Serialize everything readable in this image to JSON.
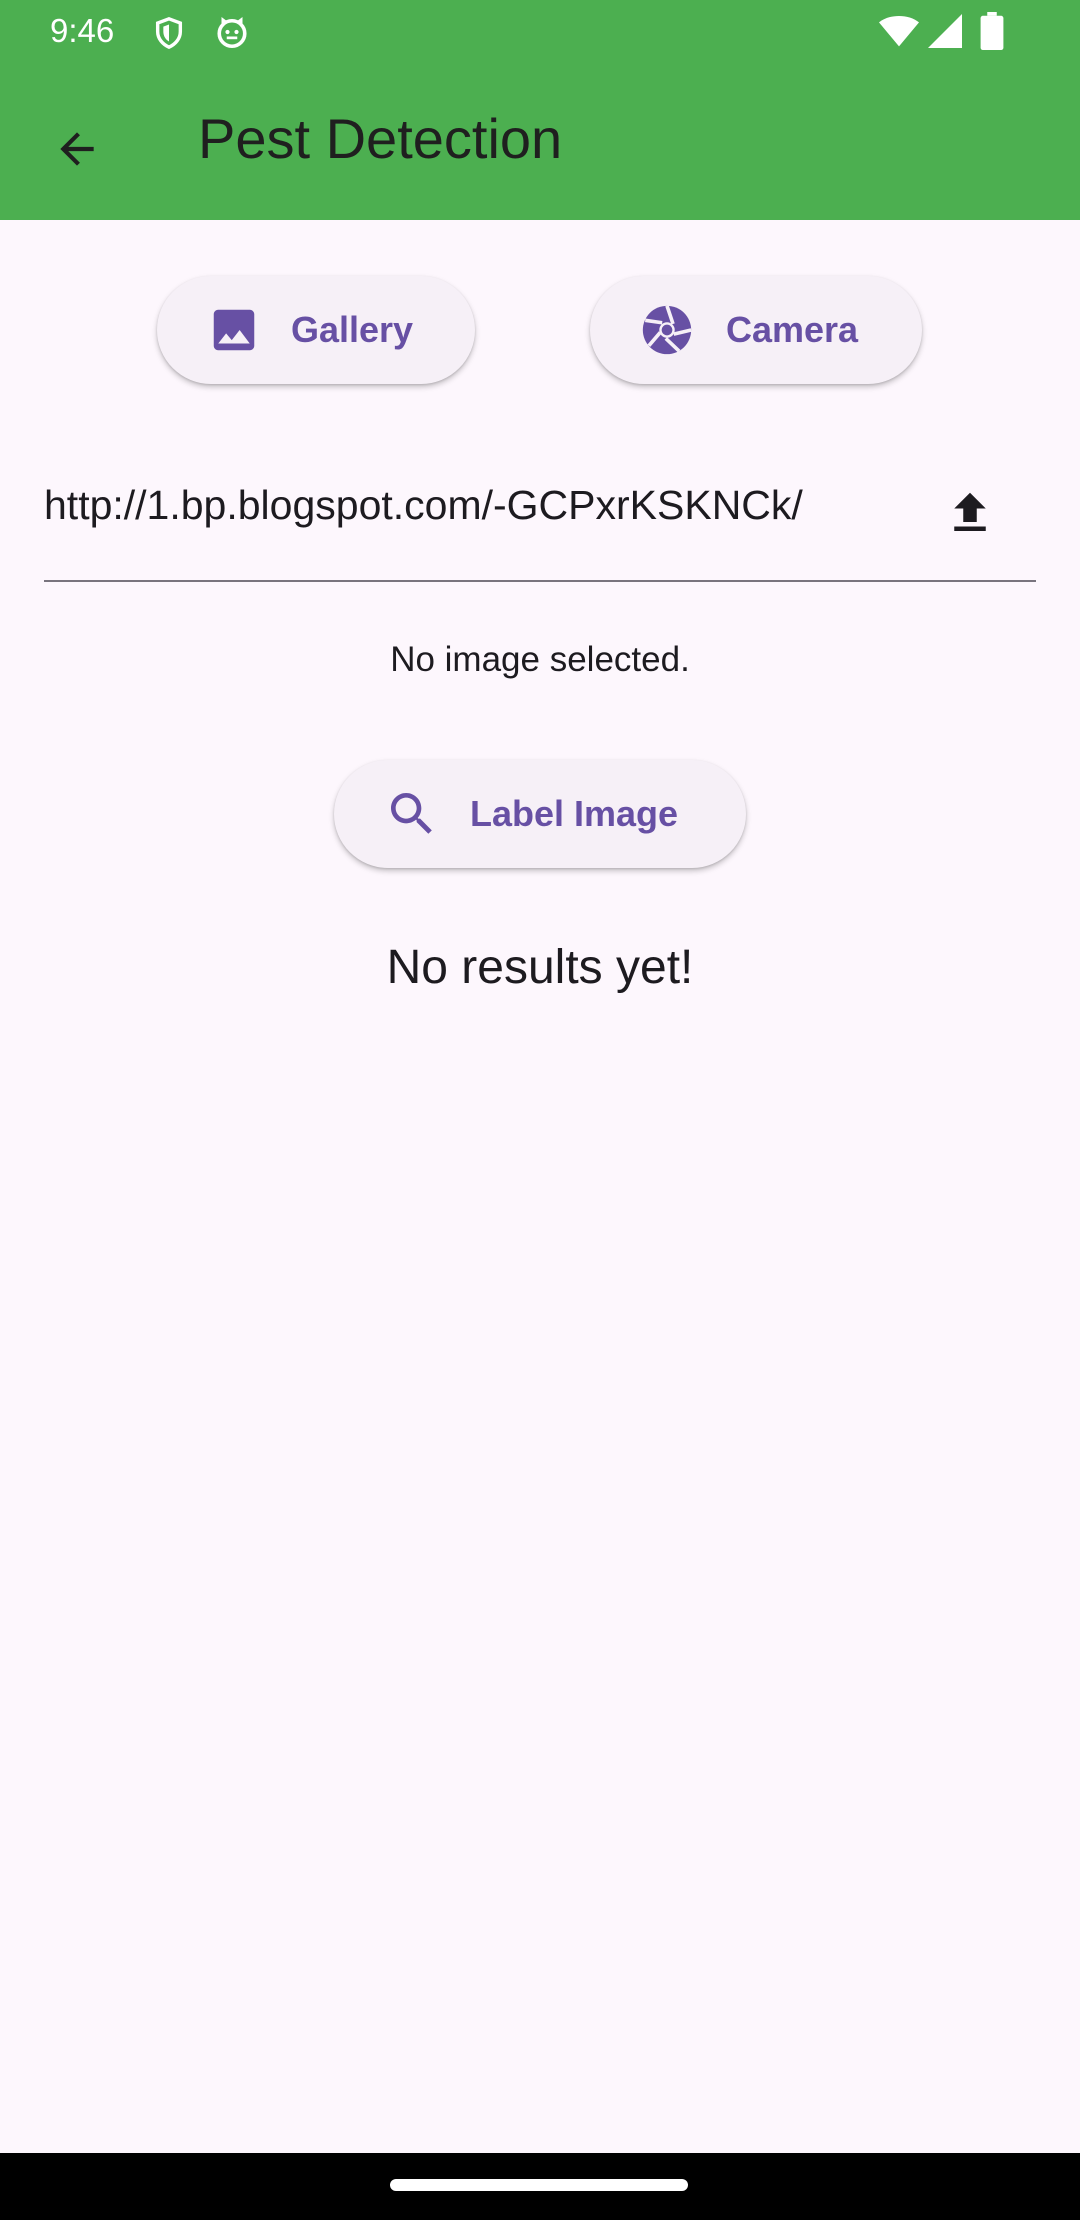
{
  "status_bar": {
    "time": "9:46",
    "icons": [
      "shield-icon",
      "cat-face-icon",
      "wifi-icon",
      "signal-icon",
      "battery-icon"
    ]
  },
  "app_bar": {
    "title": "Pest Detection",
    "back_icon": "arrow-left-icon",
    "background_color": "#4CAF50"
  },
  "actions": {
    "gallery_label": "Gallery",
    "camera_label": "Camera",
    "accent_color": "#6750A4"
  },
  "url_input": {
    "value": "http://1.bp.blogspot.com/-GCPxrKSKNCk/",
    "upload_icon": "upload-icon"
  },
  "main": {
    "no_image_text": "No image selected.",
    "label_button": "Label Image",
    "no_results_text": "No results yet!"
  }
}
